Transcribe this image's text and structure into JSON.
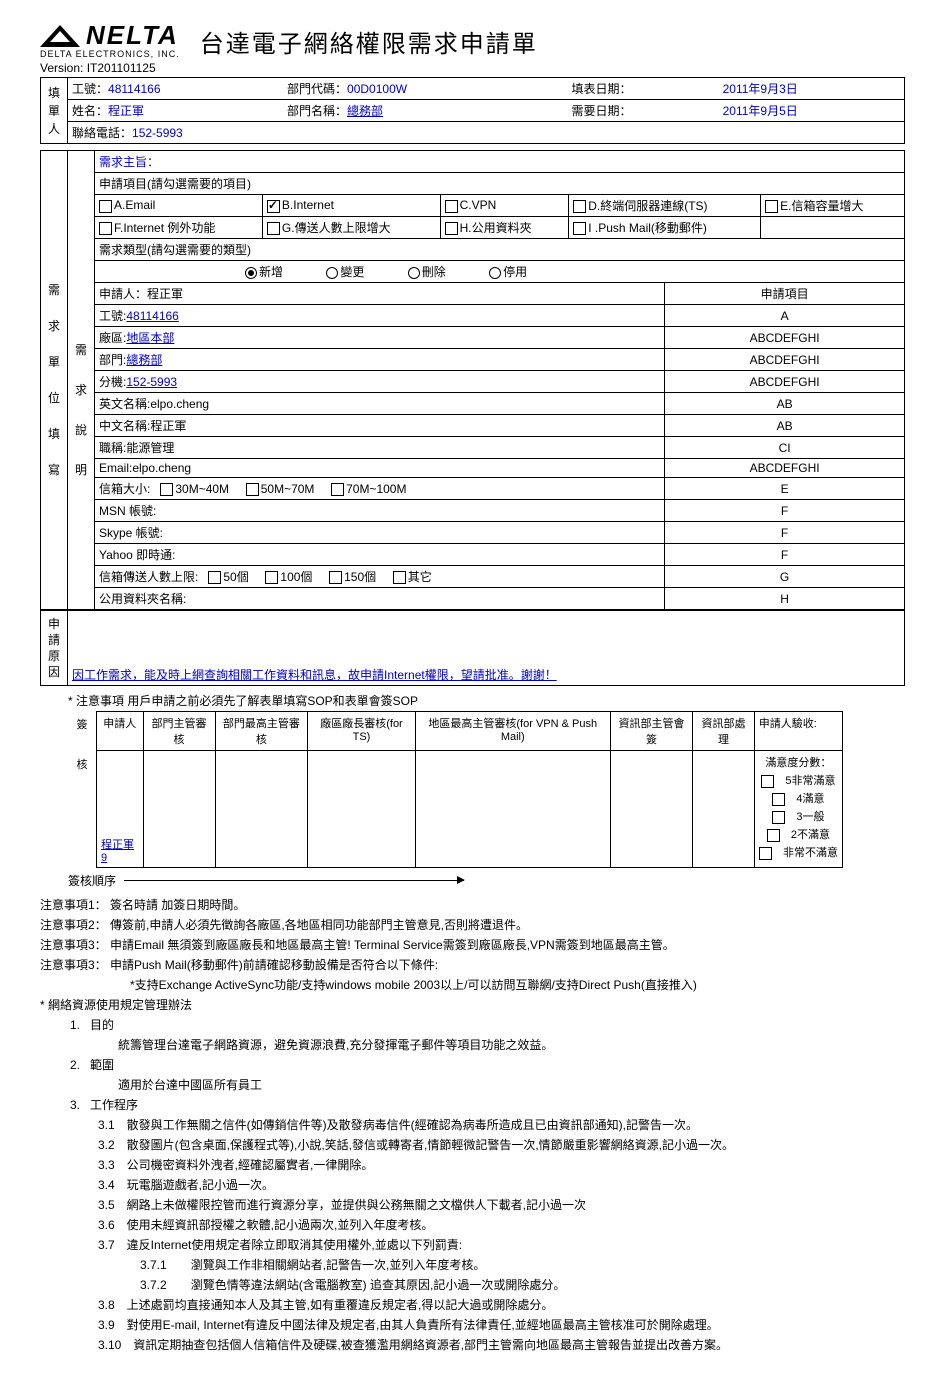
{
  "company": {
    "name": "NELTA",
    "sub": "DELTA ELECTRONICS, INC."
  },
  "title": "台達電子網絡權限需求申請單",
  "version_label": "Version:",
  "version": "IT201101125",
  "labels": {
    "filler": "填單人",
    "unit_fill": "需求單位填寫",
    "req_desc": "需求說明",
    "app_reason": "申請原因",
    "sign": "簽核"
  },
  "info": {
    "emp_no_label": "工號：",
    "emp_no": "48114166",
    "name_label": "姓名：",
    "name": "程正軍",
    "phone_label": "聯絡電話：",
    "phone": "152-5993",
    "dept_code_label": "部門代碼：",
    "dept_code": "00D0100W",
    "dept_name_label": "部門名稱：",
    "dept_name": "總務部",
    "fill_date_label": "填表日期：",
    "fill_date": "2011年9月3日",
    "need_date_label": "需要日期：",
    "need_date": "2011年9月5日"
  },
  "req": {
    "subject_label": "需求主旨：",
    "items_label": "申請項目(請勾選需要的項目)",
    "options": {
      "a": "A.Email",
      "b": "B.Internet",
      "c": "C.VPN",
      "d": "D.終端伺服器連線(TS)",
      "e": "E.信箱容量增大",
      "f": "F.Internet 例外功能",
      "g": "G.傳送人數上限增大",
      "h": "H.公用資料夾",
      "i": "I .Push Mail(移動郵件)"
    },
    "type_label": "需求類型(請勾選需要的類型)",
    "types": {
      "add": "新增",
      "change": "變更",
      "delete": "刪除",
      "stop": "停用"
    }
  },
  "applicant": {
    "header_left": "申請人：程正軍",
    "header_right": "申請項目",
    "rows": [
      {
        "l": "工號:",
        "v": "48114166",
        "r": "A",
        "link": true
      },
      {
        "l": "廠區:",
        "v": "地區本部",
        "r": "ABCDEFGHI",
        "link": true
      },
      {
        "l": "部門:",
        "v": "總務部",
        "r": "ABCDEFGHI",
        "link": true
      },
      {
        "l": "分機:",
        "v": "152-5993",
        "r": "ABCDEFGHI",
        "link": true
      },
      {
        "l": "英文名稱:",
        "v": "elpo.cheng",
        "r": "AB",
        "link": false
      },
      {
        "l": "中文名稱:",
        "v": "程正軍",
        "r": "AB",
        "link": false
      },
      {
        "l": "職稱:",
        "v": "能源管理",
        "r": "CI",
        "link": false
      },
      {
        "l": "Email:",
        "v": "elpo.cheng",
        "r": "ABCDEFGHI",
        "link": false
      }
    ],
    "mailbox_label": "信箱大小:",
    "mailbox_opts": [
      "30M~40M",
      "50M~70M",
      "70M~100M"
    ],
    "mailbox_r": "E",
    "msn": "MSN 帳號:",
    "skype": "Skype 帳號:",
    "yahoo": "Yahoo 即時通:",
    "fr": "F",
    "send_limit_label": "信箱傳送人數上限:",
    "send_opts": [
      "50個",
      "100個",
      "150個",
      "其它"
    ],
    "send_r": "G",
    "folder_label": "公用資料夾名稱:",
    "folder_r": "H"
  },
  "reason": "因工作需求，能及時上網查詢相關工作資料和訊息，故申請Internet權限，望請批准。謝謝！",
  "sop_note": "* 注意事項  用戶申請之前必須先了解表單填寫SOP和表單會簽SOP",
  "sig_headers": [
    "申請人",
    "部門主管審核",
    "部門最高主管審核",
    "廠區廠長審核(for TS)",
    "地區最高主管審核(for VPN & Push Mail)",
    "資訊部主管會簽",
    "資訊部處理",
    "申請人驗收:"
  ],
  "sig_applicant": "程正軍9",
  "satisfaction": {
    "title": "滿意度分數：",
    "opts": [
      "5非常滿意",
      "4滿意",
      "3一般",
      "2不滿意",
      "非常不滿意"
    ]
  },
  "arrow_label": "簽核順序",
  "notes_list": [
    "注意事項1： 簽名時請 加簽日期時間。",
    "注意事項2： 傳簽前,申請人必須先徵詢各廠區,各地區相同功能部門主管意見,否則將遭退件。",
    "注意事項3： 申請Email 無須簽到廠區廠長和地區最高主管! Terminal Service需簽到廠區廠長,VPN需簽到地區最高主管。",
    "注意事項3： 申請Push Mail(移動郵件)前請確認移動設備是否符合以下條件:"
  ],
  "push_note": "*支持Exchange ActiveSync功能/支持windows mobile 2003以上/可以訪問互聯網/支持Direct Push(直接推入)",
  "policy_title": "*  網絡資源使用規定管理辦法",
  "policy": {
    "p1_t": "目的",
    "p1_b": "統籌管理台達電子網路資源，避免資源浪費,充分發揮電子郵件等項目功能之效益。",
    "p2_t": "範圍",
    "p2_b": "適用於台達中國區所有員工",
    "p3_t": "工作程序",
    "p3": [
      "3.1　散發與工作無關之信件(如傳銷信件等)及散發病毒信件(經確認為病毒所造成且已由資訊部通知),記警告一次。",
      "3.2　散發圖片(包含桌面,保護程式等),小說,笑話,發信或轉寄者,情節輕微記警告一次,情節嚴重影響網絡資源,記小過一次。",
      "3.3　公司機密資料外洩者,經確認屬實者,一律開除。",
      "3.4　玩電腦遊戲者,記小過一次。",
      "3.5　網路上未做權限控管而進行資源分享，並提供與公務無關之文檔供人下載者,記小過一次",
      "3.6　使用未經資訊部授權之軟體,記小過兩次,並列入年度考核。",
      "3.7　違反Internet使用規定者除立即取消其使用權外,並處以下列罰責:",
      "3.8　上述處罰均直接通知本人及其主管,如有重覆違反規定者,得以記大過或開除處分。",
      "3.9　對使用E-mail, Internet有違反中國法律及規定者,由其人負責所有法律責任,並經地區最高主管核准可於開除處理。",
      "3.10　資訊定期抽查包括個人信箱信件及硬碟,被查獲濫用網絡資源者,部門主管需向地區最高主管報告並提出改善方案。"
    ],
    "p3_7": [
      "3.7.1　　瀏覽與工作非相關網站者,記警告一次,並列入年度考核。",
      "3.7.2　　瀏覽色情等違法網站(含電腦教室) 追查其原因,記小過一次或開除處分。"
    ]
  }
}
